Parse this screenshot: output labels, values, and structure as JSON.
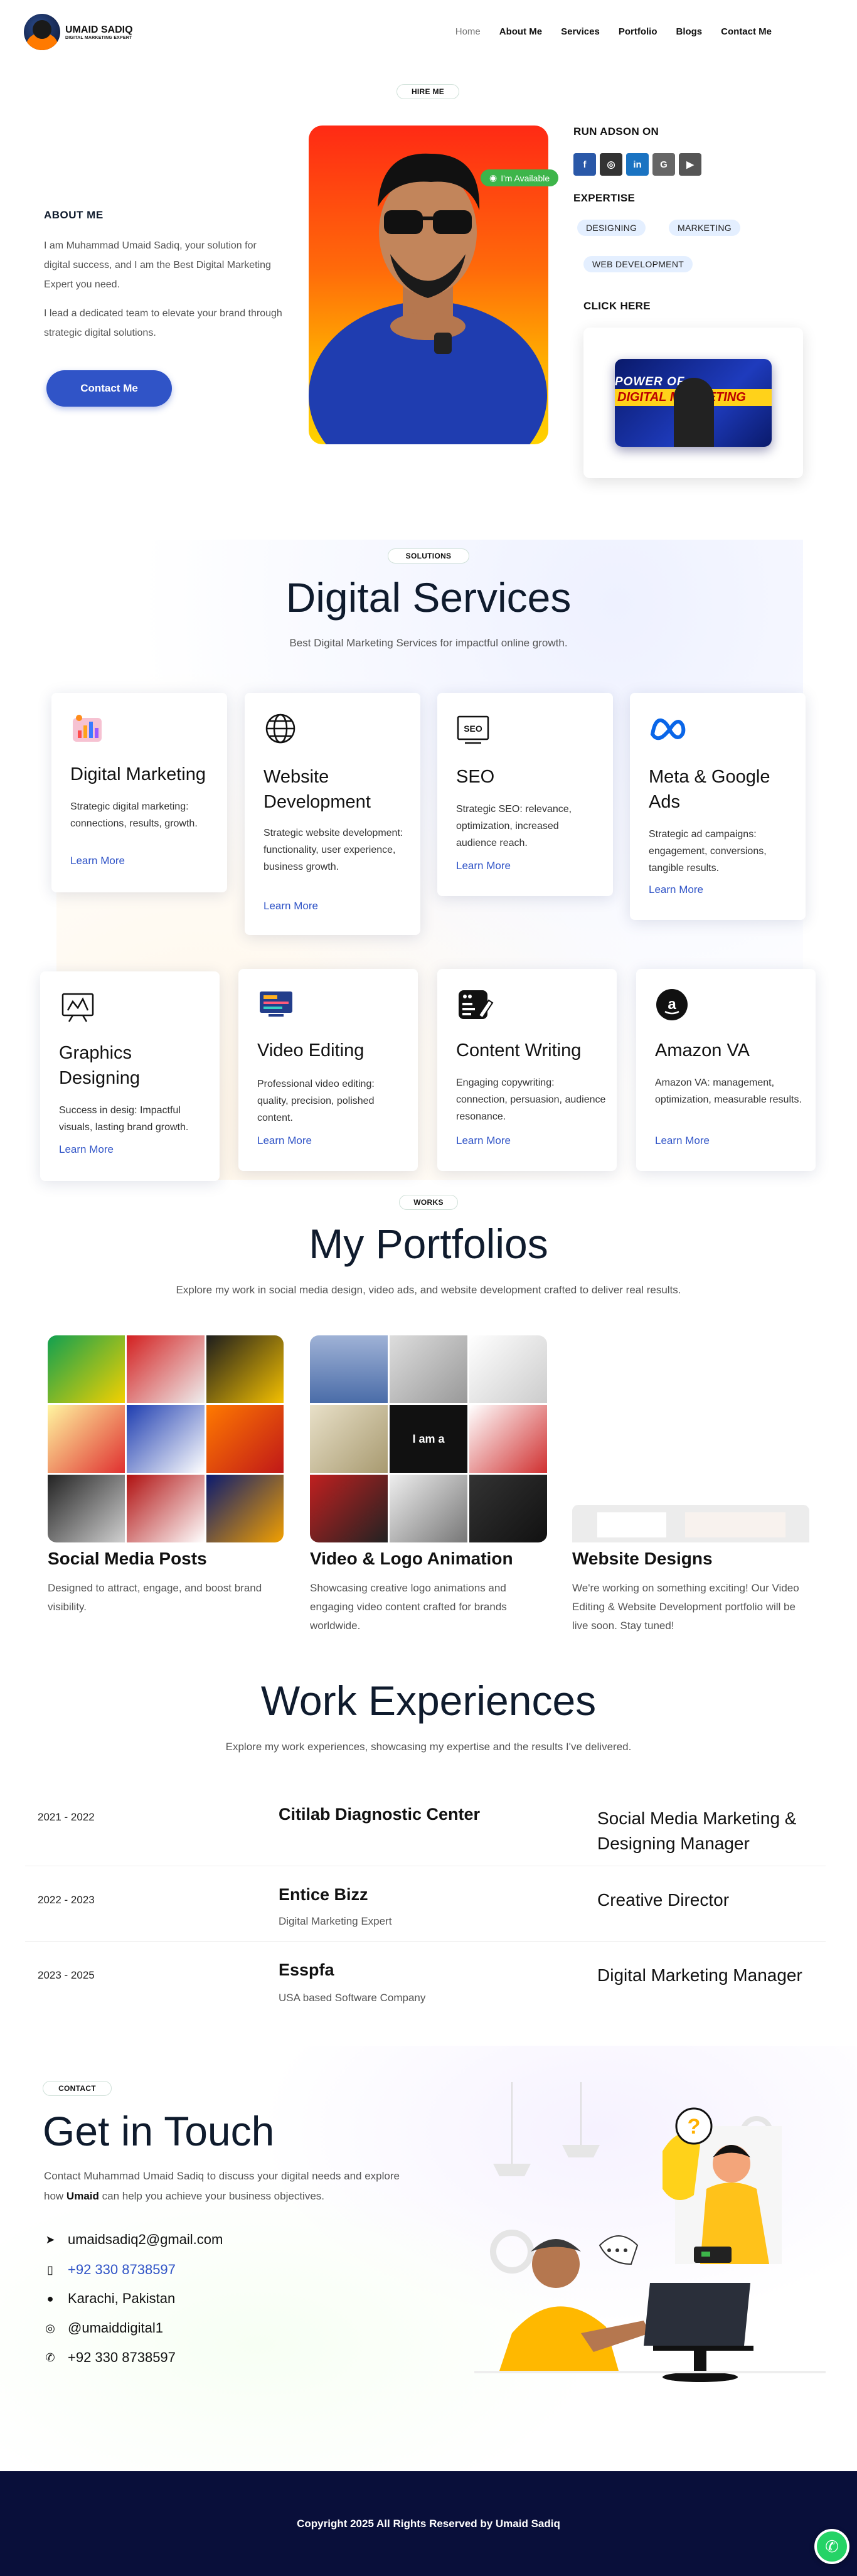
{
  "header": {
    "brand_name": "UMAID SADIQ",
    "brand_tagline": "DIGITAL MARKETING EXPERT",
    "nav": [
      "Home",
      "About Me",
      "Services",
      "Portfolio",
      "Blogs",
      "Contact Me"
    ]
  },
  "hero": {
    "badge": "HIRE ME",
    "about_heading": "ABOUT ME",
    "about_p1": "I am Muhammad Umaid Sadiq, your solution for digital success, and I am the Best Digital Marketing Expert you need.",
    "about_p2": "I lead a dedicated team to elevate your brand through strategic digital solutions.",
    "contact_button": "Contact Me",
    "availability": "I'm Available",
    "run_heading": "RUN ADSON ON",
    "social_icons": [
      "facebook-icon",
      "instagram-icon",
      "linkedin-icon",
      "google-icon",
      "youtube-icon"
    ],
    "expertise_heading": "EXPERTISE",
    "expertise_tags": [
      "DESIGNING",
      "MARKETING",
      "WEB DEVELOPMENT"
    ],
    "click_heading": "CLICK HERE",
    "thumb_line1": "POWER OF",
    "thumb_line2": "DIGITAL MARKETING"
  },
  "services": {
    "badge": "SOLUTIONS",
    "title": "Digital Services",
    "subtitle": "Best Digital Marketing Services for impactful online growth.",
    "learn_more": "Learn More",
    "items": [
      {
        "title": "Digital Marketing",
        "desc": "Strategic digital marketing: connections, results, growth.",
        "icon": "chart-icon"
      },
      {
        "title": "Website Development",
        "desc": "Strategic website development: functionality, user experience, business growth.",
        "icon": "globe-icon"
      },
      {
        "title": "SEO",
        "desc": "Strategic SEO: relevance, optimization, increased audience reach.",
        "icon": "seo-icon"
      },
      {
        "title": "Meta & Google Ads",
        "desc": "Strategic ad campaigns: engagement, conversions, tangible results.",
        "icon": "meta-icon"
      },
      {
        "title": "Graphics Designing",
        "desc": "Success in desig: Impactful visuals, lasting brand growth.",
        "icon": "design-icon"
      },
      {
        "title": "Video Editing",
        "desc": "Professional video editing: quality, precision, polished content.",
        "icon": "video-icon"
      },
      {
        "title": "Content Writing",
        "desc": "Engaging copywriting: connection, persuasion, audience resonance.",
        "icon": "content-icon"
      },
      {
        "title": "Amazon VA",
        "desc": "Amazon VA: management, optimization, measurable results.",
        "icon": "amazon-icon"
      }
    ]
  },
  "portfolio": {
    "badge": "WORKS",
    "title": "My Portfolios",
    "subtitle": "Explore my work in social media design, video ads, and website development crafted to deliver real results.",
    "items": [
      {
        "title": "Social Media Posts",
        "desc": "Designed to attract, engage, and boost brand visibility."
      },
      {
        "title": "Video & Logo Animation",
        "desc": "Showcasing creative logo animations and engaging video content crafted for brands worldwide."
      },
      {
        "title": "Website Designs",
        "desc": "We're working on something exciting! Our Video Editing & Website Development portfolio will be live soon. Stay tuned!"
      }
    ],
    "tile_text": "I am a"
  },
  "experience": {
    "title": "Work Experiences",
    "subtitle": "Explore my work experiences, showcasing my expertise and the results I've delivered.",
    "items": [
      {
        "years": "2021 - 2022",
        "company": "Citilab Diagnostic Center",
        "sub": "",
        "role": "Social Media Marketing & Designing Manager"
      },
      {
        "years": "2022 - 2023",
        "company": "Entice Bizz",
        "sub": "Digital Marketing Expert",
        "role": "Creative Director"
      },
      {
        "years": "2023 - 2025",
        "company": "Esspfa",
        "sub": "USA based Software Company",
        "role": "Digital Marketing Manager"
      }
    ]
  },
  "contact": {
    "badge": "CONTACT",
    "title": "Get in Touch",
    "desc_pre": "Contact Muhammad Umaid Sadiq to discuss your digital needs and explore how ",
    "desc_bold": "Umaid",
    "desc_post": " can help you achieve your business objectives.",
    "email": "umaidsadiq2@gmail.com",
    "phone": "+92 330 8738597",
    "location": "Karachi, Pakistan",
    "instagram": "@umaiddigital1",
    "whatsapp": "+92 330 8738597"
  },
  "footer": {
    "copyright": "Copyright 2025 All Rights Reserved by Umaid Sadiq"
  },
  "colors": {
    "accent": "#3054c7",
    "available": "#3db54a",
    "footer_bg": "#090f3a",
    "whatsapp": "#25d366"
  }
}
